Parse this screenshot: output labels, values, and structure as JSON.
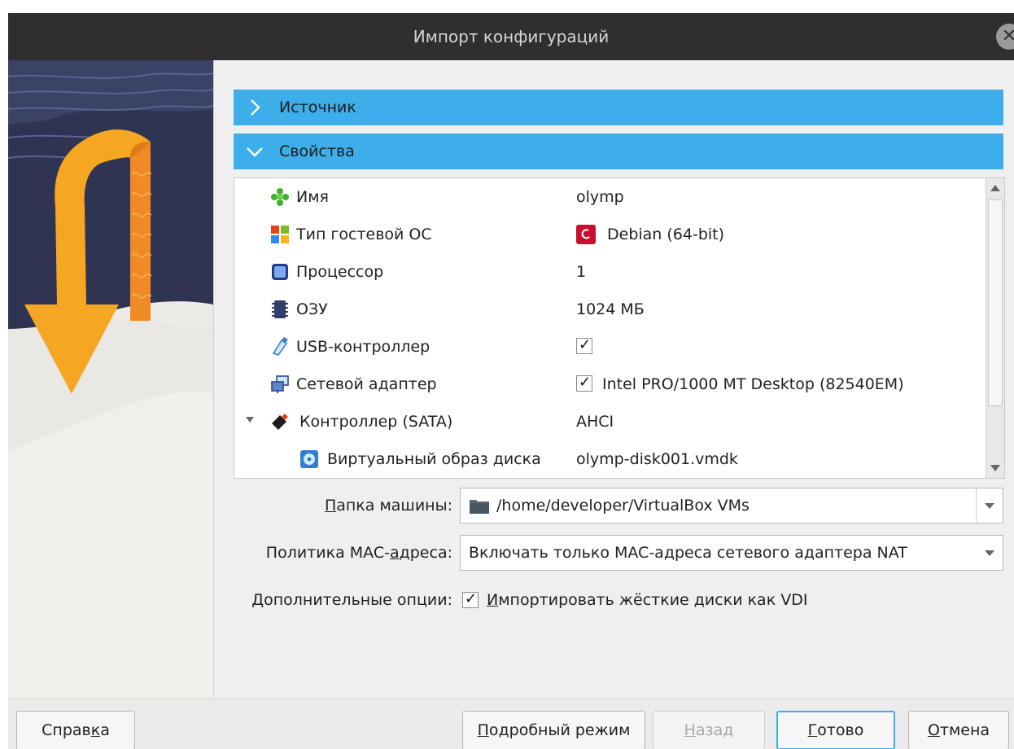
{
  "window": {
    "title": "Импорт конфигураций",
    "close_glyph": "✕"
  },
  "sections": {
    "source": {
      "label": "Источник",
      "expanded": false
    },
    "properties": {
      "label": "Свойства",
      "expanded": true
    }
  },
  "properties": [
    {
      "name": "Имя",
      "value": "olymp",
      "icon": "puzzle-icon"
    },
    {
      "name": "Тип гостевой ОС",
      "value": "Debian (64-bit)",
      "icon": "os-type-icon",
      "value_icon": "debian-icon"
    },
    {
      "name": "Процессор",
      "value": "1",
      "icon": "cpu-icon"
    },
    {
      "name": "ОЗУ",
      "value": "1024 МБ",
      "icon": "ram-icon"
    },
    {
      "name": "USB-контроллер",
      "value": "",
      "checked": true,
      "icon": "usb-icon"
    },
    {
      "name": "Сетевой адаптер",
      "value": "Intel PRO/1000 MT Desktop (82540EM)",
      "checked": true,
      "icon": "network-icon"
    },
    {
      "name": "Контроллер (SATA)",
      "value": "AHCI",
      "icon": "sata-controller-icon",
      "expanded": true
    },
    {
      "name": "Виртуальный образ диска",
      "value": "olymp-disk001.vmdk",
      "icon": "disk-image-icon"
    }
  ],
  "fields": {
    "machine_folder": {
      "label_pre": "",
      "label_mnemonic": "П",
      "label_post": "апка машины:",
      "value": "/home/developer/VirtualBox VMs"
    },
    "mac_policy": {
      "label_pre": "Политика MAC-",
      "label_mnemonic": "а",
      "label_post": "дреса:",
      "value": "Включать только MAC-адреса сетевого адаптера NAT"
    },
    "additional": {
      "label": "Дополнительные опции:",
      "option_mnemonic": "И",
      "option_rest": "мпортировать жёсткие диски как VDI",
      "checked": true
    }
  },
  "buttons": {
    "help": {
      "pre": "Справ",
      "mnemonic": "к",
      "post": "а"
    },
    "expert": {
      "pre": "",
      "mnemonic": "П",
      "post": "одробный режим"
    },
    "back": {
      "pre": "",
      "mnemonic": "Н",
      "post": "азад",
      "enabled": false
    },
    "finish": {
      "pre": "",
      "mnemonic": "Г",
      "post": "отово"
    },
    "cancel": {
      "pre": "",
      "mnemonic": "О",
      "post": "тмена"
    }
  },
  "colors": {
    "accent": "#3daee9",
    "titlebar": "#2f2f2f",
    "art_arrow": "#f5a623",
    "art_ribbon": "#f08a24",
    "art_night": "#2e3452"
  }
}
